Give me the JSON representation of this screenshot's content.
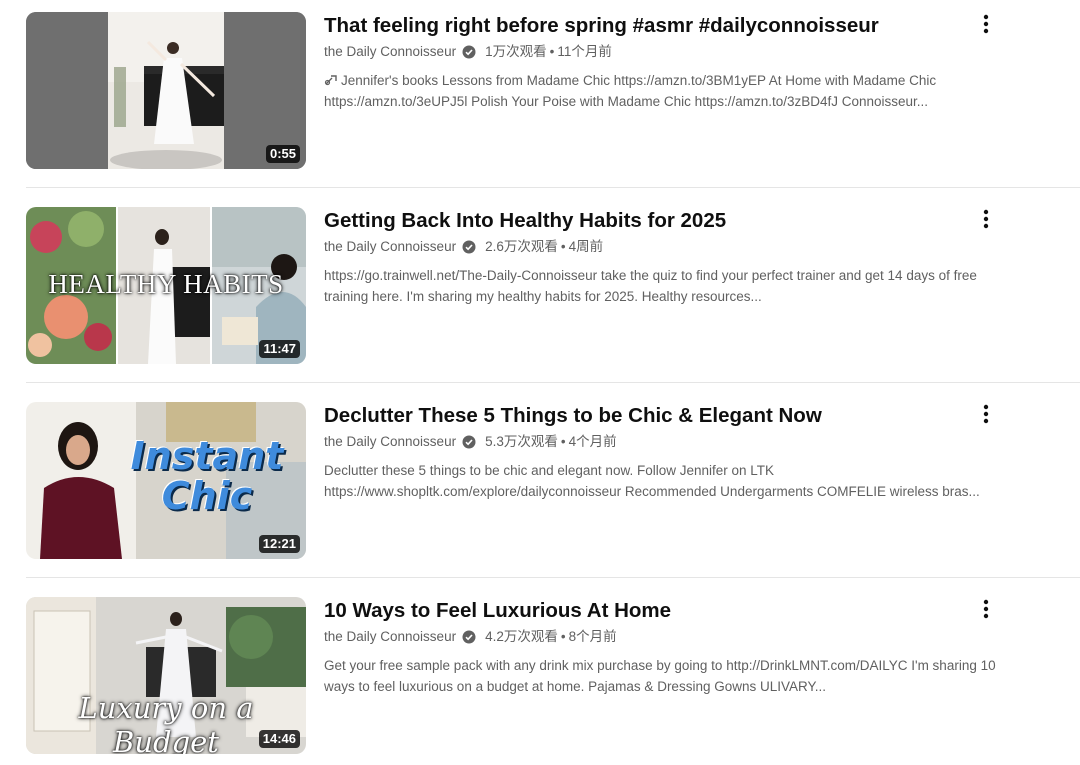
{
  "videos": [
    {
      "title": "That feeling right before spring #asmr #dailyconnoisseur",
      "channel": "the Daily Connoisseur",
      "views": "1万次观看",
      "age": "11个月前",
      "desc_line1": "Jennifer's books Lessons from Madame Chic https://amzn.to/3BM1yEP At Home with Madame Chic",
      "desc_line2": "https://amzn.to/3eUPJ5l Polish Your Poise with Madame Chic https://amzn.to/3zBD4fJ Connoisseur...",
      "duration": "0:55",
      "thumb_text": ""
    },
    {
      "title": "Getting Back Into Healthy Habits for 2025",
      "channel": "the Daily Connoisseur",
      "views": "2.6万次观看",
      "age": "4周前",
      "desc_line1": "https://go.trainwell.net/The-Daily-Connoisseur take the quiz to find your perfect trainer and get 14 days of free",
      "desc_line2": "training here. I'm sharing my healthy habits for 2025. Healthy resources...",
      "duration": "11:47",
      "thumb_text": "HEALTHY HABITS"
    },
    {
      "title": "Declutter These 5 Things to be Chic & Elegant Now",
      "channel": "the Daily Connoisseur",
      "views": "5.3万次观看",
      "age": "4个月前",
      "desc_line1": "Declutter these 5 things to be chic and elegant now. Follow Jennifer on LTK",
      "desc_line2": "https://www.shopltk.com/explore/dailyconnoisseur Recommended Undergarments COMFELIE wireless bras...",
      "duration": "12:21",
      "thumb_text": "Instant Chic"
    },
    {
      "title": "10 Ways to Feel Luxurious At Home",
      "channel": "the Daily Connoisseur",
      "views": "4.2万次观看",
      "age": "8个月前",
      "desc_line1": "Get your free sample pack with any drink mix purchase by going to http://DrinkLMNT.com/DAILYC I'm sharing 10",
      "desc_line2": "ways to feel luxurious on a budget at home. Pajamas & Dressing Gowns ULIVARY...",
      "duration": "14:46",
      "thumb_text": "Luxury on a Budget"
    }
  ],
  "separator": "•",
  "icons": {
    "verified": "verified-check-icon",
    "more": "more-vert-icon",
    "link": "link-icon"
  }
}
